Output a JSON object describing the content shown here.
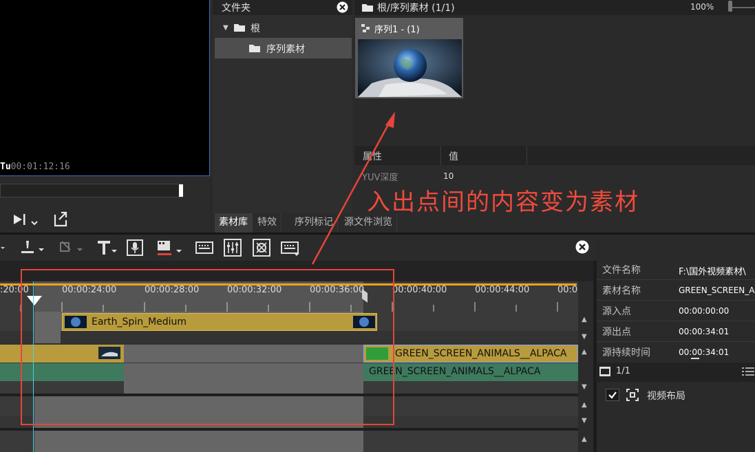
{
  "preview": {
    "timecode_prefix": "Tu",
    "timecode": "00:01:12:16"
  },
  "folder_panel": {
    "title": "文件夹",
    "items": [
      {
        "label": "根",
        "expanded": true
      },
      {
        "label": "序列素材",
        "selected": true
      }
    ]
  },
  "bin": {
    "path": "根/序列素材 (1/1)",
    "zoom": "100%",
    "clip": {
      "name": "序列1 - (1)"
    }
  },
  "properties": {
    "col_attr": "属性",
    "col_value": "值",
    "rows": [
      {
        "key": "YUV深度",
        "value": "10"
      }
    ]
  },
  "tabs": [
    "素材库",
    "特效",
    "序列标记",
    "源文件浏览"
  ],
  "right_panel": {
    "rows": [
      {
        "key": "文件名称",
        "value": "F:\\国外视频素材\\"
      },
      {
        "key": "素材名称",
        "value": "GREEN_SCREEN_AN"
      },
      {
        "key": "源入点",
        "value": "00:00:00:00"
      },
      {
        "key": "源出点",
        "value": "00:00:34:01"
      },
      {
        "key": "源持续时间",
        "value": "00:00:34:01"
      }
    ],
    "page": "1/1",
    "layout_label": "视频布局"
  },
  "timeline": {
    "ticks": [
      ":20:00",
      "00:00:24:00",
      "00:00:28:00",
      "00:00:32:00",
      "00:00:36:00",
      "00:00:40:00",
      "00:00:44:00",
      "00:0"
    ],
    "clips": {
      "earth": "Earth_Spin_Medium",
      "green_video": "GREEN_SCREEN_ANIMALS__ALPACA",
      "green_audio": "GREEN_SCREEN_ANIMALS__ALPACA"
    }
  },
  "annotation": "入出点间的内容变为素材",
  "colors": {
    "clip_yellow": "#b89b3c",
    "clip_green": "#3e7a5e",
    "annotation_red": "#e8443a",
    "ruler_orange": "#f0a020",
    "cursor_cyan": "#4fd0e0"
  }
}
